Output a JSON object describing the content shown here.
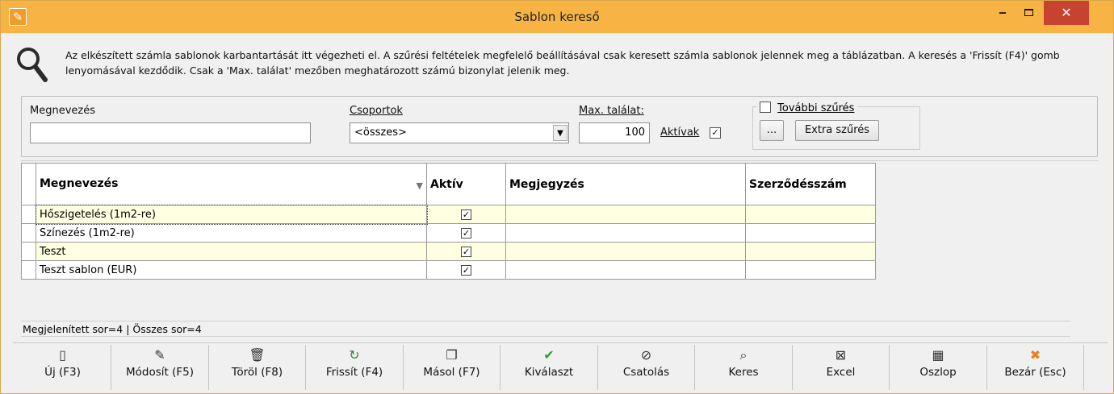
{
  "window": {
    "title": "Sablon kereső",
    "minimize_glyph": "‒",
    "close_glyph": "✕"
  },
  "info": {
    "text": "Az elkészített számla sablonok karbantartását itt végezheti el. A szűrési feltételek megfelelő beállításával csak keresett számla sablonok jelennek meg a táblázatban. A keresés a 'Frissít (F4)' gomb lenyomásával kezdődik. Csak a 'Max. találat' mezőben meghatározott számú bizonylat jelenik meg."
  },
  "filters": {
    "name_label": "Megnevezés",
    "name_value": "",
    "groups_label": "Csoportok",
    "groups_value": "<összes>",
    "max_label": "Max. találat:",
    "max_value": "100",
    "active_label": "Aktívak",
    "active_checked": true,
    "more_label": "További szűrés",
    "more_checked": false,
    "dots_label": "...",
    "extra_label": "Extra szűrés"
  },
  "grid": {
    "columns": [
      "Megnevezés",
      "Aktív",
      "Megjegyzés",
      "Szerződésszám"
    ],
    "rows": [
      {
        "name": "Hőszigetelés (1m2-re)",
        "active": true,
        "note": "",
        "contract": ""
      },
      {
        "name": "Színezés (1m2-re)",
        "active": true,
        "note": "",
        "contract": ""
      },
      {
        "name": "Teszt",
        "active": true,
        "note": "",
        "contract": ""
      },
      {
        "name": "Teszt sablon (EUR)",
        "active": true,
        "note": "",
        "contract": ""
      }
    ],
    "sort_indicator": "▼"
  },
  "status": {
    "text": "Megjelenített sor=4 | Összes sor=4"
  },
  "toolbar": [
    {
      "name": "new-button",
      "icon": "file-icon",
      "glyph": "▯",
      "label": "Új (F3)",
      "color": "#333333"
    },
    {
      "name": "edit-button",
      "icon": "edit-icon",
      "glyph": "✎",
      "label": "Módosít (F5)",
      "color": "#333333"
    },
    {
      "name": "delete-button",
      "icon": "trash-icon",
      "glyph": "🗑",
      "label": "Töröl (F8)",
      "color": "#333333"
    },
    {
      "name": "refresh-button",
      "icon": "refresh-icon",
      "glyph": "↻",
      "label": "Frissít (F4)",
      "color": "#2e8b3a"
    },
    {
      "name": "copy-button",
      "icon": "copy-icon",
      "glyph": "❐",
      "label": "Másol (F7)",
      "color": "#333333"
    },
    {
      "name": "select-button",
      "icon": "check-circle-icon",
      "glyph": "✔",
      "label": "Kiválaszt",
      "color": "#2e9b3a"
    },
    {
      "name": "attach-button",
      "icon": "paperclip-icon",
      "glyph": "⊘",
      "label": "Csatolás",
      "color": "#333333"
    },
    {
      "name": "search-button",
      "icon": "search-icon",
      "glyph": "⌕",
      "label": "Keres",
      "color": "#333333"
    },
    {
      "name": "excel-button",
      "icon": "excel-icon",
      "glyph": "⊠",
      "label": "Excel",
      "color": "#333333"
    },
    {
      "name": "columns-button",
      "icon": "table-icon",
      "glyph": "▦",
      "label": "Oszlop",
      "color": "#333333"
    },
    {
      "name": "close-window-button",
      "icon": "close-icon",
      "glyph": "✖",
      "label": "Bezár (Esc)",
      "color": "#e8811a"
    }
  ]
}
